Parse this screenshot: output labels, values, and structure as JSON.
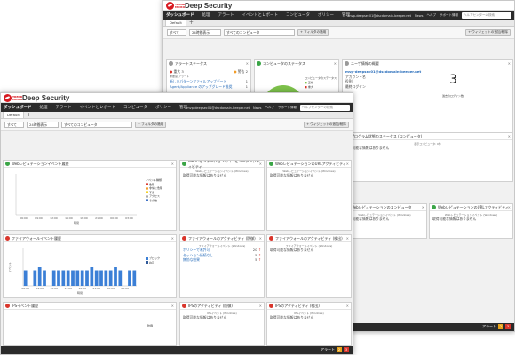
{
  "app": {
    "logo_text": "TREND MICRO",
    "product_name": "Deep Security",
    "nav": [
      "ダッシュボード",
      "処理",
      "アラート",
      "イベントとレポート",
      "コンピュータ",
      "ポリシー",
      "管理"
    ],
    "host_label": "masterCI",
    "account_label": "mvp-deepsec01@dscdomain-beeper.net",
    "news_label": "News",
    "help_label": "ヘルプ",
    "support_label": "サポート情報",
    "search_placeholder": "ヘルプセンターの検索",
    "tab_default": "Default",
    "tab_add": "+",
    "filter_all": "すべて",
    "filter_time": "24時間表示",
    "filter_computers": "すべてのコンピュータ",
    "filter_add": "+ フィルタの適用",
    "add_widget": "+ ウィジェットの追加/削除",
    "status_alerts": "アラート",
    "status_count_a": "3",
    "status_count_b": "2"
  },
  "back": {
    "alert_status": {
      "title": "アラートステータス",
      "critical_label": "重大",
      "critical_count": "3",
      "warning_label": "警告",
      "warning_count": "2",
      "col_type": "重要度/アラート",
      "row1": "新しいパターンファイルアップデート",
      "row1_count": "1",
      "row2": "Agent/Appliance のアップグレード推奨",
      "row2_count": "1"
    },
    "computer_status": {
      "title": "コンピュータのステータス",
      "line1": "コンピュータのステータス",
      "line2": "正常",
      "line3": "重大"
    },
    "user_activity": {
      "title": "ユーザ情報の概要",
      "user": "mvp-deepsec01@dscdomain-beeper.net",
      "account": "アカウント名",
      "role": "役割",
      "last_login": "最終ログイン",
      "big_number": "3",
      "big_caption": "過去のログイン数"
    },
    "prog_status": {
      "title": "プログラム状態のステータス (コンピュータ)",
      "line": "表示コンピュータ: 0件"
    },
    "row_b": {
      "p1_title": "Webレピュテーションのコンピュータ",
      "p1_sub": "Webレピュテーションイベント (Windows)",
      "p2_title": "WebレピュテーションのURLアクティビティ",
      "p2_sub": "Webレピュテーションイベント (Windows)"
    },
    "no_data": "取得可能な情報はありません"
  },
  "front": {
    "web_rep": {
      "title": "Webレピュテーションイベント履歴",
      "legend_title": "イベント種類",
      "legend": [
        {
          "label": "危険",
          "color": "#d9352b"
        },
        {
          "label": "非常に危険",
          "color": "#f29c27"
        },
        {
          "label": "不審",
          "color": "#f2d024"
        },
        {
          "label": "アクセス",
          "color": "#aaaaaa"
        },
        {
          "label": "その他",
          "color": "#3b6fc4"
        }
      ],
      "x_ticks": [
        "06:00",
        "09:00",
        "12:00",
        "15:00",
        "18:00",
        "21:00",
        "00:00",
        "03:00"
      ],
      "x_label": "時間"
    },
    "web_comp": {
      "title": "Webレピュテーションのコンピュータアクティビティ",
      "sub": "Webレピュテーションイベント (Windows)"
    },
    "web_url": {
      "title": "WebレピュテーションのURLアクティビティ",
      "sub": "Webレピュテーションイベント (Windows)"
    },
    "fw_hist": {
      "title": "ファイアウォールイベント履歴",
      "legend": [
        {
          "label": "ブロック",
          "color": "#3b7fd6"
        },
        {
          "label": "許可",
          "color": "#2f5a9a"
        }
      ],
      "y_label": "イベント",
      "x_label": "時間"
    },
    "fw_comp": {
      "title": "ファイアウォールのアクティビティ (防御)",
      "sub": "ファイアウォールイベント (Windows)",
      "rows": [
        {
          "label": "ポリシーで未許可",
          "value": "20"
        },
        {
          "label": "セッション接続なし",
          "value": "5"
        },
        {
          "label": "無効な結果",
          "value": "5"
        }
      ]
    },
    "fw_act": {
      "title": "ファイアウォールのアクティビティ (検出)",
      "sub": "ファイアウォールイベント (Windows)"
    },
    "ips_hist": {
      "title": "IPSイベント履歴",
      "legend_word": "防御"
    },
    "ips_comp": {
      "title": "IPSのアクティビティ (防御)",
      "sub": "IPSイベント (Windows)"
    },
    "ips_act": {
      "title": "IPSのアクティビティ (検出)",
      "sub": "IPSイベント (Windows)"
    }
  },
  "chart_data": [
    {
      "type": "line",
      "title": "Webレピュテーションイベント履歴",
      "x": [
        "06:00",
        "09:00",
        "12:00",
        "15:00",
        "18:00",
        "21:00",
        "00:00",
        "03:00"
      ],
      "series": [],
      "xlabel": "時間"
    },
    {
      "type": "bar",
      "title": "ファイアウォールイベント履歴",
      "categories": [
        "06:00",
        "",
        "",
        "09:00",
        "",
        "",
        "12:00",
        "",
        "",
        "15:00",
        "",
        "",
        "18:00",
        "",
        "",
        "21:00",
        "",
        "",
        "00:00",
        "",
        "",
        "03:00",
        "",
        ""
      ],
      "series": [
        {
          "name": "ブロック",
          "values": [
            5,
            0,
            5,
            6,
            5,
            0,
            5,
            5,
            5,
            5,
            5,
            5,
            5,
            5,
            6,
            5,
            5,
            5,
            5,
            6,
            5,
            0,
            5,
            5
          ]
        }
      ],
      "ylabel": "イベント",
      "xlabel": "時間",
      "ylim": [
        0,
        12
      ]
    }
  ],
  "colors": {
    "brand_red": "#d71920",
    "navbar": "#2b2b2b",
    "bar_blue": "#3b7fd6",
    "pie_green": "#7dc24b"
  }
}
